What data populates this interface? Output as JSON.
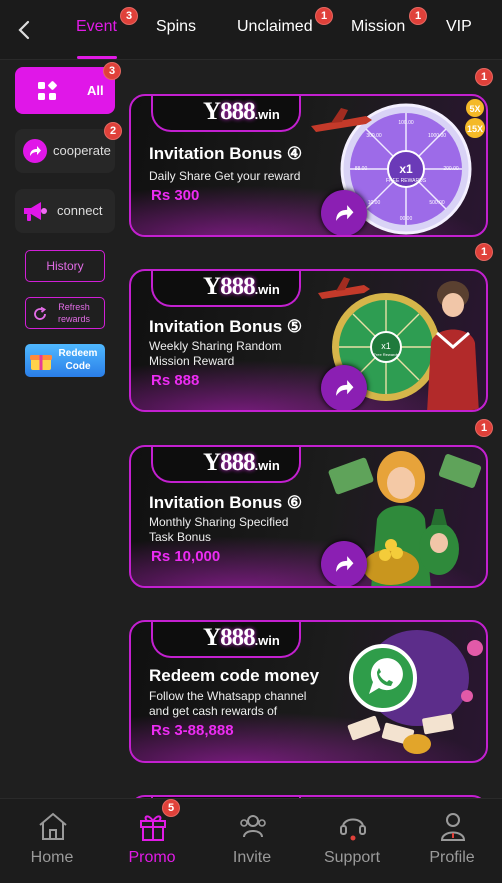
{
  "tabs": [
    {
      "label": "Event",
      "badge": "3",
      "active": true
    },
    {
      "label": "Spins"
    },
    {
      "label": "Unclaimed",
      "badge": "1"
    },
    {
      "label": "Mission",
      "badge": "1"
    },
    {
      "label": "VIP"
    }
  ],
  "sidebar": {
    "all": {
      "label": "All",
      "badge": "3"
    },
    "cooperate": {
      "label": "cooperate",
      "badge": "2"
    },
    "connect": {
      "label": "connect"
    },
    "history": "History",
    "refresh": "Refresh rewards",
    "redeem": "Redeem Code"
  },
  "logo": {
    "y": "Y",
    "digits": "888",
    "suffix": ".win"
  },
  "cards": [
    {
      "title": "Invitation Bonus ④",
      "desc": "Daily Share  Get your reward",
      "amount": "Rs 300",
      "badge": "1"
    },
    {
      "title": "Invitation Bonus ⑤",
      "desc": "Weekly Sharing Random Mission Reward",
      "amount": "Rs 888",
      "badge": "1"
    },
    {
      "title": "Invitation Bonus ⑥",
      "desc": "Monthly Sharing Specified Task Bonus",
      "amount": "Rs 10,000",
      "badge": "1"
    },
    {
      "title": "Redeem code money",
      "desc": "Follow the Whatsapp channel and get cash rewards of",
      "amount": "Rs 3-88,888"
    }
  ],
  "wheel": {
    "center_text": "x1",
    "sub_text": "FREE REWARDS",
    "sub_text_2": "Free Rewards",
    "segment_labels": [
      "100.00",
      "1000.00",
      "200.00",
      "500.00",
      "88.00",
      "10.00",
      "300.00",
      "00 00"
    ]
  },
  "multipliers": [
    "5X",
    "15X"
  ],
  "bottom_nav": [
    {
      "label": "Home"
    },
    {
      "label": "Promo",
      "badge": "5",
      "active": true
    },
    {
      "label": "Invite"
    },
    {
      "label": "Support"
    },
    {
      "label": "Profile"
    }
  ],
  "colors": {
    "accent": "#e11be6",
    "badge": "#e0413a",
    "background": "#1f1f1f"
  }
}
